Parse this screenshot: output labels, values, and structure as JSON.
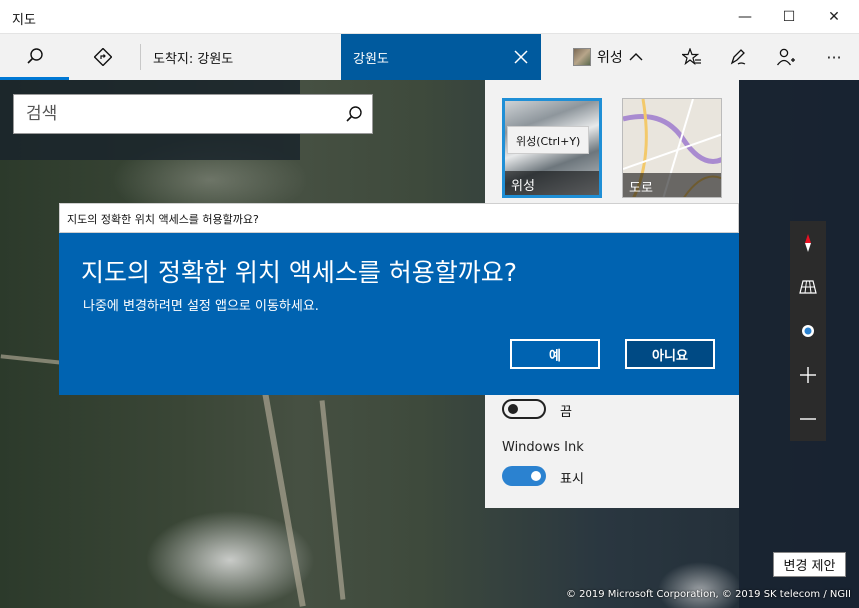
{
  "window": {
    "title": "지도",
    "minimize_glyph": "—",
    "maximize_glyph": "☐",
    "close_glyph": "✕"
  },
  "toolbar": {
    "search_icon": "search-icon",
    "directions_icon": "directions-icon",
    "breadcrumb": "도착지:  강원도",
    "active_tab": "강원도",
    "map_style_label": "위성",
    "more_glyph": "···"
  },
  "search": {
    "placeholder": "검색"
  },
  "map_style_panel": {
    "tooltip": "위성(Ctrl+Y)",
    "satellite_label": "위성",
    "road_label": "도로",
    "traffic_toggle": {
      "state": "off",
      "label": "끔"
    },
    "windows_ink_title": "Windows Ink",
    "windows_ink_toggle": {
      "state": "on",
      "label": "표시"
    }
  },
  "dialog": {
    "title_bar": "지도의 정확한 위치 액세스를 허용할까요?",
    "heading": "지도의 정확한 위치 액세스를 허용할까요?",
    "message": "나중에 변경하려면 설정 앱으로 이동하세요.",
    "yes_label": "예",
    "no_label": "아니요"
  },
  "map": {
    "suggest_edit": "변경 제안",
    "copyright": "© 2019 Microsoft Corporation, © 2019 SK telecom / NGII"
  },
  "colors": {
    "accent": "#0078d4",
    "dialog_bg": "#0063b1",
    "active_tab_bg": "#005a9e",
    "toggle_on": "#2b82d0"
  }
}
